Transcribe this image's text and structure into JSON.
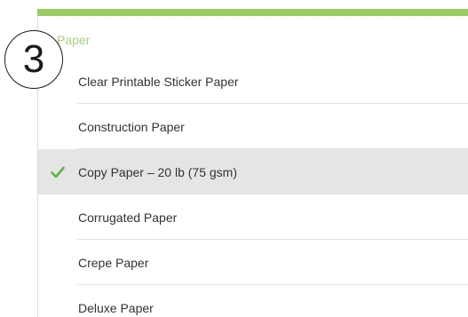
{
  "step_number": "3",
  "section_header": "Paper",
  "accent_color": "#9acd61",
  "check_color": "#5bb54a",
  "materials": [
    {
      "label": "Clear Printable Sticker Paper",
      "selected": false
    },
    {
      "label": "Construction Paper",
      "selected": false
    },
    {
      "label": "Copy Paper – 20 lb (75 gsm)",
      "selected": true
    },
    {
      "label": "Corrugated Paper",
      "selected": false
    },
    {
      "label": "Crepe Paper",
      "selected": false
    },
    {
      "label": "Deluxe Paper",
      "selected": false
    }
  ],
  "icons": {
    "selected_marker": "checkmark-icon"
  }
}
